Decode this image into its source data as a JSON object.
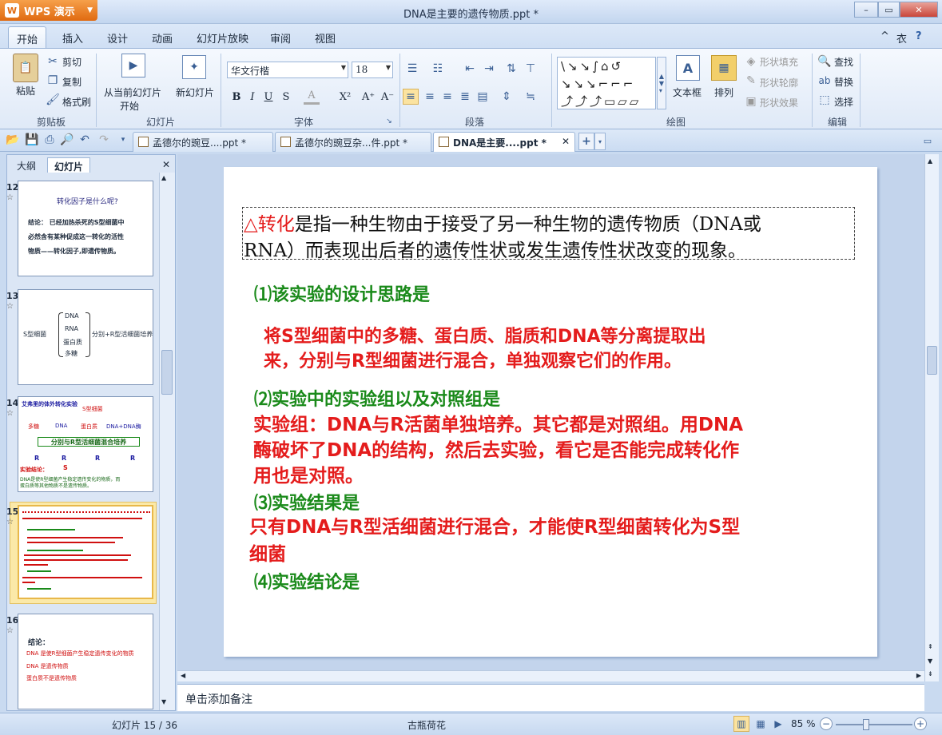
{
  "app": {
    "name": "WPS 演示",
    "logo_letter": "W"
  },
  "window": {
    "title": "DNA是主要的遗传物质.ppt *",
    "minimize": "–",
    "restore": "▭",
    "close": "✕"
  },
  "menu": {
    "tabs": [
      "开始",
      "插入",
      "设计",
      "动画",
      "幻灯片放映",
      "审阅",
      "视图"
    ],
    "active": "开始",
    "right_icons": [
      "^",
      "衣",
      "?"
    ]
  },
  "ribbon": {
    "clipboard": {
      "paste": "粘贴",
      "cut": "剪切",
      "copy": "复制",
      "format_painter": "格式刷",
      "label": "剪贴板"
    },
    "slides": {
      "from_current_1": "从当前幻灯片",
      "from_current_2": "开始",
      "new_slide": "新幻灯片",
      "label": "幻灯片"
    },
    "font": {
      "name": "华文行楷",
      "size": "18",
      "label": "字体",
      "buttons": [
        "B",
        "I",
        "U",
        "S",
        "A",
        "X²",
        "A⁺",
        "A⁻"
      ]
    },
    "paragraph": {
      "label": "段落"
    },
    "drawing": {
      "shapes_rows": [
        "\\↘↘∫⌂↺",
        "↘↘↘⌐⌐⌐",
        "⤴⤴⤴▭▱▱"
      ],
      "textbox": "文本框",
      "arrange": "排列",
      "shape_fill": "形状填充",
      "shape_outline": "形状轮廓",
      "shape_effect": "形状效果",
      "label": "绘图"
    },
    "edit": {
      "find": "查找",
      "replace": "替换",
      "select": "选择",
      "label": "编辑"
    }
  },
  "doc_tabs": [
    {
      "name": "孟德尔的豌豆....ppt *",
      "active": false
    },
    {
      "name": "孟德尔的豌豆杂...件.ppt *",
      "active": false
    },
    {
      "name": "DNA是主要....ppt *",
      "active": true
    }
  ],
  "left_pane": {
    "tabs": [
      "大纲",
      "幻灯片"
    ],
    "active_tab": "幻灯片",
    "thumbnails": [
      {
        "num": "12",
        "lines": [
          "转化因子是什么呢?",
          "结论：  已经加热杀死的S型细菌中",
          "必然含有某种促成这一转化的活性",
          "物质——转化因子,即遗传物质。"
        ]
      },
      {
        "num": "13",
        "lines": [
          "DNA",
          "RNA",
          "蛋白质",
          "多糖",
          "S型细菌",
          "分别+R型活细菌培养"
        ]
      },
      {
        "num": "14",
        "lines": [
          "艾弗里的体外转化实验",
          "S型细菌",
          "多糖",
          "DNA",
          "蛋白质",
          "DNA+DNA酶",
          "分别与R型活细菌混合培养",
          "R",
          "R",
          "R",
          "R",
          "S",
          "实验结论：",
          "DNA是使R型细菌产生稳定遗传变化的物质，而",
          "蛋白质等其他物质不是遗传物质。"
        ]
      },
      {
        "num": "15",
        "selected": true
      },
      {
        "num": "16",
        "lines": [
          "结论：",
          "DNA 是使R型细菌产生稳定遗传变化的物质",
          "DNA 是遗传物质",
          "蛋白质不是遗传物质"
        ]
      }
    ]
  },
  "slide": {
    "intro_marker": "△转化",
    "intro_rest_1": "是指一种生物由于接受了另一种生物的遗传物质（DNA或",
    "intro_line_2": "RNA）而表现出后者的遗传性状或发生遗传性状改变的现象。",
    "q1": "⑴该实验的设计思路是",
    "a1_line1": "将S型细菌中的多糖、蛋白质、脂质和DNA等分离提取出",
    "a1_line2": "来，分别与R型细菌进行混合，单独观察它们的作用。",
    "q2": "⑵实验中的实验组以及对照组是",
    "a2_line1": "实验组：DNA与R活菌单独培养。其它都是对照组。用DNA",
    "a2_line2": "酶破坏了DNA的结构，然后去实验，看它是否能完成转化作",
    "a2_line3": "用也是对照。",
    "q3": "⑶实验结果是",
    "a3_line1": "只有DNA与R型活细菌进行混合，才能使R型细菌转化为S型",
    "a3_line2": "细菌",
    "q4": "⑷实验结论是"
  },
  "notes_placeholder": "单击添加备注",
  "status": {
    "slide_info": "幻灯片 15 / 36",
    "theme": "古瓶荷花",
    "zoom": "85 %"
  },
  "colors": {
    "red": "#e41c1c",
    "green": "#1a8a1a"
  }
}
